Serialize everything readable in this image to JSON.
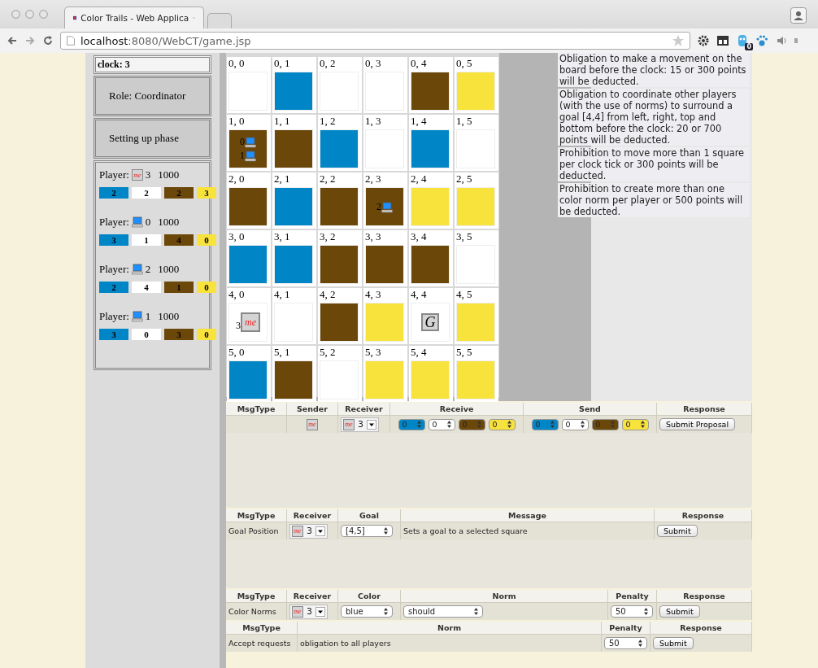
{
  "browser": {
    "tabs": [
      {
        "title": "Color Trails - Web Applica",
        "selected": true
      },
      {
        "selected": false
      }
    ],
    "url": "**localhost**:8080/WebCT/game.jsp",
    "extension_badge": "0"
  },
  "sidebar": {
    "clock": "clock: 3",
    "role": "Role: Coordinator",
    "phase": "Setting up phase",
    "players": [
      {
        "label": "Player:",
        "kind": "me",
        "badge": "me",
        "id": "3",
        "score": "1000",
        "chips": [
          {
            "color": "#0085c7",
            "count": "2"
          },
          {
            "color": "#ffffff",
            "count": "2"
          },
          {
            "color": "#6b4709",
            "count": "2"
          },
          {
            "color": "#f8e23c",
            "count": "3"
          }
        ]
      },
      {
        "label": "Player:",
        "kind": "computer",
        "id": "0",
        "score": "1000",
        "chips": [
          {
            "color": "#0085c7",
            "count": "3"
          },
          {
            "color": "#ffffff",
            "count": "1"
          },
          {
            "color": "#6b4709",
            "count": "4"
          },
          {
            "color": "#f8e23c",
            "count": "0"
          }
        ]
      },
      {
        "label": "Player:",
        "kind": "computer",
        "id": "2",
        "score": "1000",
        "chips": [
          {
            "color": "#0085c7",
            "count": "2"
          },
          {
            "color": "#ffffff",
            "count": "4"
          },
          {
            "color": "#6b4709",
            "count": "1"
          },
          {
            "color": "#f8e23c",
            "count": "0"
          }
        ]
      },
      {
        "label": "Player:",
        "kind": "computer",
        "id": "1",
        "score": "1000",
        "chips": [
          {
            "color": "#0085c7",
            "count": "3"
          },
          {
            "color": "#ffffff",
            "count": "0"
          },
          {
            "color": "#6b4709",
            "count": "3"
          },
          {
            "color": "#f8e23c",
            "count": "0"
          }
        ]
      }
    ]
  },
  "board": {
    "rows": [
      {
        "cells": [
          {
            "label": "0, 0",
            "color": "#ffffff"
          },
          {
            "label": "0, 1",
            "color": "#0085c7"
          },
          {
            "label": "0, 2",
            "color": "#ffffff"
          },
          {
            "label": "0, 3",
            "color": "#ffffff"
          },
          {
            "label": "0, 4",
            "color": "#6b4709"
          },
          {
            "label": "0, 5",
            "color": "#f8e23c"
          }
        ]
      },
      {
        "cells": [
          {
            "label": "1, 0",
            "color": "#6b4709",
            "tokens": [
              {
                "kind": "computer",
                "id": "0"
              },
              {
                "kind": "computer",
                "id": "1"
              }
            ]
          },
          {
            "label": "1, 1",
            "color": "#6b4709"
          },
          {
            "label": "1, 2",
            "color": "#0085c7"
          },
          {
            "label": "1, 3",
            "color": "#ffffff"
          },
          {
            "label": "1, 4",
            "color": "#0085c7"
          },
          {
            "label": "1, 5",
            "color": "#ffffff"
          }
        ]
      },
      {
        "cells": [
          {
            "label": "2, 0",
            "color": "#6b4709"
          },
          {
            "label": "2, 1",
            "color": "#0085c7"
          },
          {
            "label": "2, 2",
            "color": "#6b4709"
          },
          {
            "label": "2, 3",
            "color": "#6b4709",
            "tokens": [
              {
                "kind": "computer",
                "id": "2"
              }
            ]
          },
          {
            "label": "2, 4",
            "color": "#f8e23c"
          },
          {
            "label": "2, 5",
            "color": "#f8e23c"
          }
        ]
      },
      {
        "cells": [
          {
            "label": "3, 0",
            "color": "#0085c7"
          },
          {
            "label": "3, 1",
            "color": "#0085c7"
          },
          {
            "label": "3, 2",
            "color": "#6b4709"
          },
          {
            "label": "3, 3",
            "color": "#6b4709"
          },
          {
            "label": "3, 4",
            "color": "#6b4709"
          },
          {
            "label": "3, 5",
            "color": "#ffffff"
          }
        ]
      },
      {
        "cells": [
          {
            "label": "4, 0",
            "color": "#ffffff",
            "tokens": [
              {
                "kind": "me",
                "id": "3",
                "badge": "me"
              }
            ]
          },
          {
            "label": "4, 1",
            "color": "#ffffff"
          },
          {
            "label": "4, 2",
            "color": "#6b4709"
          },
          {
            "label": "4, 3",
            "color": "#f8e23c"
          },
          {
            "label": "4, 4",
            "color": "#ffffff",
            "tokens": [
              {
                "kind": "goal",
                "label": "G"
              }
            ]
          },
          {
            "label": "4, 5",
            "color": "#f8e23c"
          }
        ]
      },
      {
        "cells": [
          {
            "label": "5, 0",
            "color": "#0085c7"
          },
          {
            "label": "5, 1",
            "color": "#6b4709"
          },
          {
            "label": "5, 2",
            "color": "#ffffff"
          },
          {
            "label": "5, 3",
            "color": "#f8e23c"
          },
          {
            "label": "5, 4",
            "color": "#f8e23c"
          },
          {
            "label": "5, 5",
            "color": "#f8e23c"
          }
        ]
      }
    ]
  },
  "norms": [
    "Obligation to make a movement on the board before the clock: 15 or 300 points will be deducted.",
    "Obligation to coordinate other players (with the use of norms) to surround a goal [4,4] from left, right, top and bottom before the clock: 20 or 700 points will be deducted.",
    "Prohibition to move more than 1 square per clock tick or 300 points will be deducted.",
    "Prohibition to create more than one color norm per player or 500 points will be deducted."
  ],
  "tables": [
    {
      "kind": "proposal",
      "columns": [
        "MsgType",
        "Sender",
        "Receiver",
        "Receive",
        "Send",
        "Response"
      ],
      "row": [
        {
          "kind": "empty"
        },
        {
          "kind": "badge",
          "badge": "me"
        },
        {
          "kind": "receiver",
          "badge": "me",
          "value": "3"
        },
        {
          "kind": "spinners",
          "items": [
            {
              "color": "#0085c7",
              "value": "0"
            },
            {
              "color": "#ffffff",
              "value": "0"
            },
            {
              "color": "#6b4709",
              "value": "0"
            },
            {
              "color": "#f8e23c",
              "value": "0"
            }
          ]
        },
        {
          "kind": "spinners",
          "items": [
            {
              "color": "#0085c7",
              "value": "0"
            },
            {
              "color": "#ffffff",
              "value": "0"
            },
            {
              "color": "#6b4709",
              "value": "0"
            },
            {
              "color": "#f8e23c",
              "value": "0"
            }
          ]
        },
        {
          "kind": "button",
          "label": "Submit Proposal"
        }
      ]
    },
    {
      "kind": "goal",
      "columns": [
        "MsgType",
        "Receiver",
        "Goal",
        "Message",
        "Response"
      ],
      "row": [
        {
          "kind": "text",
          "text": "Goal Position"
        },
        {
          "kind": "receiver",
          "badge": "me",
          "value": "3"
        },
        {
          "kind": "select",
          "value": "[4,5]"
        },
        {
          "kind": "text",
          "text": "Sets a goal to a selected square"
        },
        {
          "kind": "button",
          "label": "Submit"
        }
      ]
    },
    {
      "kind": "color_norm",
      "columns": [
        "MsgType",
        "Receiver",
        "Color",
        "Norm",
        "Penalty",
        "Response"
      ],
      "row": [
        {
          "kind": "text",
          "text": "Color Norms"
        },
        {
          "kind": "receiver",
          "badge": "me",
          "value": "3"
        },
        {
          "kind": "select",
          "value": "blue"
        },
        {
          "kind": "select",
          "value": "should"
        },
        {
          "kind": "select",
          "value": "50"
        },
        {
          "kind": "button",
          "label": "Submit"
        }
      ]
    },
    {
      "kind": "accept",
      "columns": [
        "MsgType",
        "Norm",
        "Penalty",
        "Response"
      ],
      "row": [
        {
          "kind": "text",
          "text": "Accept requests"
        },
        {
          "kind": "text",
          "text": "obligation to all players"
        },
        {
          "kind": "select",
          "value": "50"
        },
        {
          "kind": "button",
          "label": "Submit"
        }
      ]
    }
  ]
}
